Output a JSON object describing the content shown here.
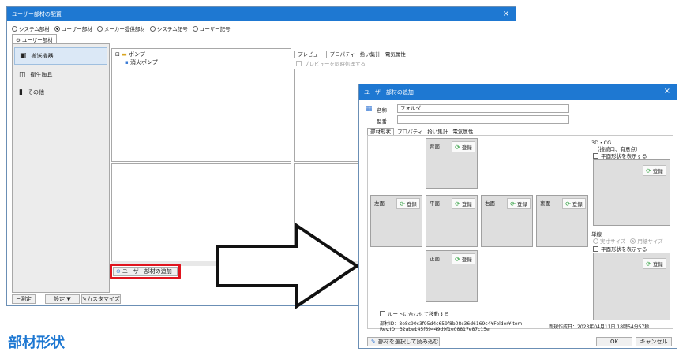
{
  "left_dialog": {
    "title": "ユーザー部材の配置",
    "close": "×",
    "radios": [
      "システム部材",
      "ユーザー部材",
      "メーカー提供部材",
      "システム記号",
      "ユーザー記号"
    ],
    "group_tab": "ユーザー部材",
    "sidebar_items": [
      "搬送機器",
      "衛生陶具",
      "その他"
    ],
    "tree": {
      "root": "ポンプ",
      "child": "消火ポンプ"
    },
    "preview_tabs": [
      "プレビュー",
      "プロパティ",
      "拾い集計",
      "電気属性"
    ],
    "preview_option": "プレビューを同時処理する",
    "add_button": "ユーザー部材の追加",
    "bottom_buttons": [
      "測定",
      "設定",
      "カスタマイズ"
    ]
  },
  "right_dialog": {
    "title": "ユーザー部材の追加",
    "close": "×",
    "name_label": "名称",
    "name_value": "フォルダ",
    "model_label": "型番",
    "model_value": "",
    "tabs": [
      "部材形状",
      "プロパティ",
      "拾い集計",
      "電気属性"
    ],
    "faces": {
      "top": "背面",
      "left": "左面",
      "front": "平面",
      "right": "右面",
      "back": "裏面",
      "bottom": "正面"
    },
    "register": "登録",
    "cg_group": {
      "title": "3D・CG",
      "subtitle": "（接続口、有意点）",
      "checkbox": "平面形状を表示する"
    },
    "unit_group": {
      "title": "単線",
      "radios": [
        "実寸サイズ",
        "用紙サイズ"
      ],
      "checkbox": "平面形状を表示する"
    },
    "route_check": "ルートに合わせて移動する",
    "part_id": "部材ID：8e8c90c3f95d4c659f8b08c36d6169c4¥Folder¥Item",
    "rev_id": "Rev.ID：32abe145f69449d9f1e08817e87c15e",
    "created": "新規作成日：2023年04月11日 18時54分57秒",
    "load_button": "部材を選択して読み込む",
    "ok": "OK",
    "cancel": "キャンセル"
  },
  "caption": "部材形状",
  "colors": {
    "titlebar": "#1e78d2",
    "highlight": "#e0141e"
  }
}
